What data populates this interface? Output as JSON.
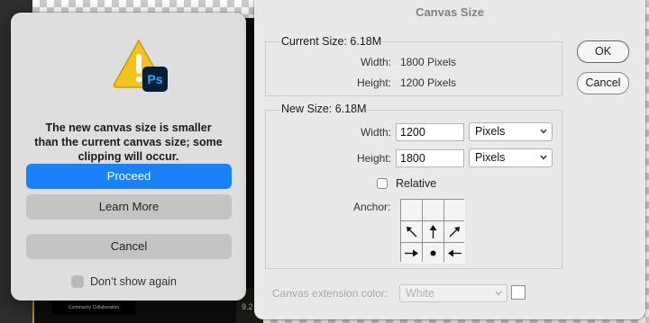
{
  "background": {
    "caption": "Community Collaboration",
    "side_value": "9.2"
  },
  "alert": {
    "icon": "warning-icon",
    "app_badge": "Ps",
    "message": "The new canvas size is smaller than the current canvas size; some clipping will occur.",
    "buttons": {
      "proceed": "Proceed",
      "learn_more": "Learn More",
      "cancel": "Cancel"
    },
    "dont_show_again": {
      "label": "Don’t show again",
      "checked": false
    },
    "colors": {
      "accent": "#1a82f9",
      "badge_bg": "#001e36",
      "badge_fg": "#31a8ff"
    }
  },
  "dialog": {
    "title": "Canvas Size",
    "current": {
      "title": "Current Size: 6.18M",
      "width_label": "Width:",
      "width_value": "1800 Pixels",
      "height_label": "Height:",
      "height_value": "1200 Pixels"
    },
    "new_size": {
      "title": "New Size: 6.18M",
      "width_label": "Width:",
      "width_value": "1200",
      "width_unit": "Pixels",
      "height_label": "Height:",
      "height_value": "1800",
      "height_unit": "Pixels",
      "relative_label": "Relative",
      "relative_checked": false,
      "anchor_label": "Anchor:",
      "anchor_arrows": [
        "",
        "",
        "",
        "arrow-up-left-icon",
        "arrow-up-icon",
        "arrow-up-right-icon",
        "arrow-left-icon",
        "anchor-dot-icon",
        "arrow-right-icon"
      ]
    },
    "buttons": {
      "ok": "OK",
      "cancel": "Cancel"
    },
    "extension": {
      "label": "Canvas extension color:",
      "value": "White"
    }
  }
}
